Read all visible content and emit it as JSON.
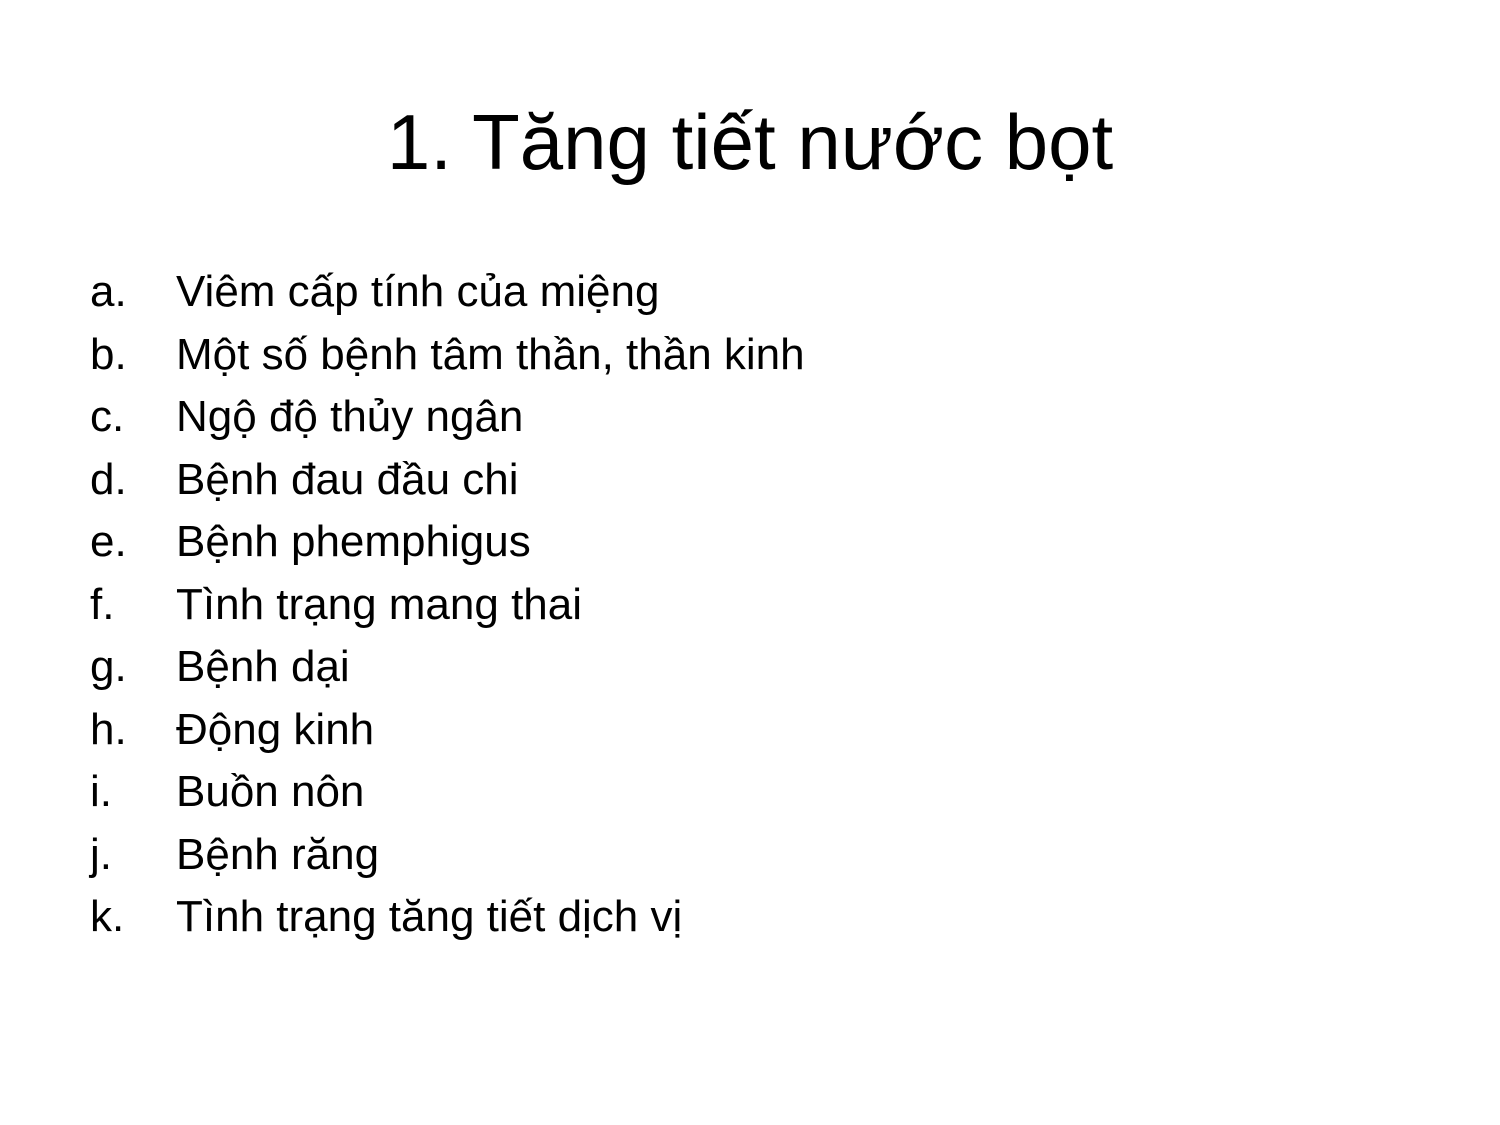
{
  "slide": {
    "title": "1. Tăng tiết nước bọt",
    "items": [
      {
        "marker": "a.",
        "text": "Viêm cấp tính của miệng"
      },
      {
        "marker": "b.",
        "text": "Một số bệnh tâm thần, thần kinh"
      },
      {
        "marker": "c.",
        "text": "Ngộ độ thủy ngân"
      },
      {
        "marker": "d.",
        "text": "Bệnh đau đầu chi"
      },
      {
        "marker": "e.",
        "text": "Bệnh phemphigus"
      },
      {
        "marker": "f.",
        "text": "Tình trạng mang thai"
      },
      {
        "marker": "g.",
        "text": "Bệnh dại"
      },
      {
        "marker": "h.",
        "text": "Động kinh"
      },
      {
        "marker": "i.",
        "text": "Buồn nôn"
      },
      {
        "marker": "j.",
        "text": "Bệnh răng"
      },
      {
        "marker": "k.",
        "text": "Tình trạng tăng tiết dịch vị"
      }
    ]
  }
}
